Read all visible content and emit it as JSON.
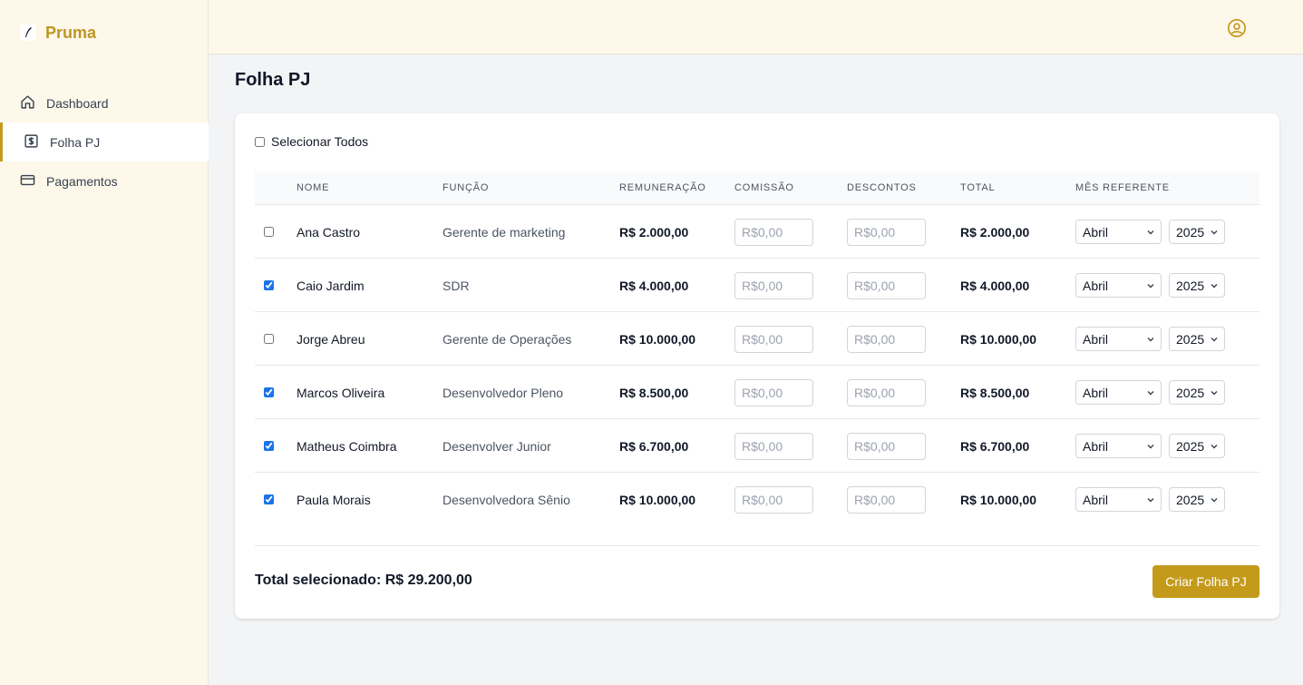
{
  "app": {
    "brand_name": "Pruma",
    "accent_color": "#c49a1b",
    "sidebar_bg": "#fdf8ea"
  },
  "sidebar": {
    "items": [
      {
        "label": "Dashboard",
        "icon": "home-icon",
        "active": false
      },
      {
        "label": "Folha PJ",
        "icon": "dollar-icon",
        "active": true
      },
      {
        "label": "Pagamentos",
        "icon": "credit-card-icon",
        "active": false
      }
    ]
  },
  "header": {
    "user_icon": "user-circle-icon"
  },
  "page": {
    "title": "Folha PJ"
  },
  "table": {
    "select_all_label": "Selecionar Todos",
    "select_all_checked": false,
    "headers": {
      "nome": "NOME",
      "funcao": "FUNÇÃO",
      "remuneracao": "REMUNERAÇÃO",
      "comissao": "COMISSÃO",
      "descontos": "DESCONTOS",
      "total": "TOTAL",
      "mes_referente": "MÊS REFERENTE"
    },
    "input_placeholder": "R$0,00",
    "rows": [
      {
        "checked": false,
        "name": "Ana Castro",
        "role": "Gerente de marketing",
        "remuneracao": "R$ 2.000,00",
        "total": "R$ 2.000,00",
        "month": "Abril",
        "year": "2025"
      },
      {
        "checked": true,
        "name": "Caio Jardim",
        "role": "SDR",
        "remuneracao": "R$ 4.000,00",
        "total": "R$ 4.000,00",
        "month": "Abril",
        "year": "2025"
      },
      {
        "checked": false,
        "name": "Jorge Abreu",
        "role": "Gerente de Operações",
        "remuneracao": "R$ 10.000,00",
        "total": "R$ 10.000,00",
        "month": "Abril",
        "year": "2025"
      },
      {
        "checked": true,
        "name": "Marcos Oliveira",
        "role": "Desenvolvedor Pleno",
        "remuneracao": "R$ 8.500,00",
        "total": "R$ 8.500,00",
        "month": "Abril",
        "year": "2025"
      },
      {
        "checked": true,
        "name": "Matheus Coimbra",
        "role": "Desenvolver Junior",
        "remuneracao": "R$ 6.700,00",
        "total": "R$ 6.700,00",
        "month": "Abril",
        "year": "2025"
      },
      {
        "checked": true,
        "name": "Paula Morais",
        "role": "Desenvolvedora Sênio",
        "remuneracao": "R$ 10.000,00",
        "total": "R$ 10.000,00",
        "month": "Abril",
        "year": "2025"
      }
    ]
  },
  "footer": {
    "total_selected": "Total selecionado: R$ 29.200,00",
    "create_button": "Criar Folha PJ"
  }
}
